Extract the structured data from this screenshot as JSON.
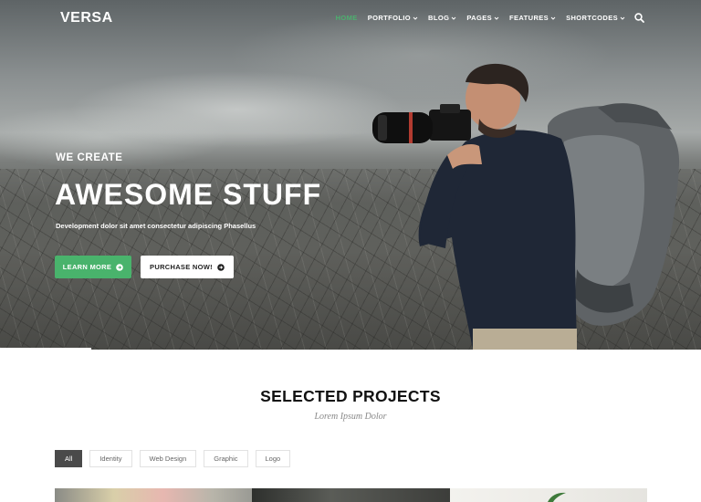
{
  "brand": {
    "logo_text": "VERSA"
  },
  "nav": {
    "items": [
      {
        "label": "HOME",
        "active": true,
        "dropdown": false
      },
      {
        "label": "PORTFOLIO",
        "active": false,
        "dropdown": true
      },
      {
        "label": "BLOG",
        "active": false,
        "dropdown": true
      },
      {
        "label": "PAGES",
        "active": false,
        "dropdown": true
      },
      {
        "label": "FEATURES",
        "active": false,
        "dropdown": true
      },
      {
        "label": "SHORTCODES",
        "active": false,
        "dropdown": true
      }
    ],
    "search_icon": "search-icon",
    "active_color": "#4caf6e"
  },
  "hero": {
    "kicker": "WE CREATE",
    "title": "AWESOME STUFF",
    "subtitle": "Development dolor sit amet consectetur adipiscing Phasellus",
    "learn_more_label": "LEARN MORE",
    "purchase_label": "PURCHASE NOW!",
    "accent_color": "#49b36c"
  },
  "projects": {
    "title": "SELECTED PROJECTS",
    "subtitle": "Lorem Ipsum Dolor",
    "filters": [
      {
        "label": "All",
        "active": true
      },
      {
        "label": "Identity",
        "active": false
      },
      {
        "label": "Web Design",
        "active": false
      },
      {
        "label": "Graphic",
        "active": false
      },
      {
        "label": "Logo",
        "active": false
      }
    ]
  }
}
